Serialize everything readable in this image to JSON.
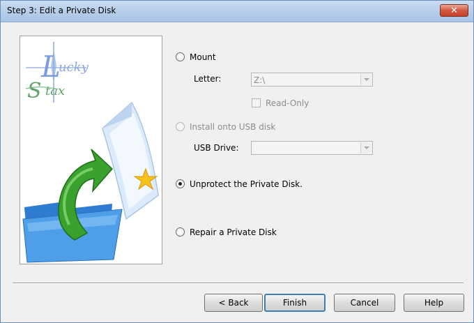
{
  "window": {
    "title": "Step 3: Edit a Private Disk",
    "close_glyph": "✕"
  },
  "logo": {
    "brand_text": "Lucky Stax"
  },
  "options": {
    "mount": {
      "label": "Mount",
      "selected": false
    },
    "letter": {
      "label": "Letter:",
      "value": "Z:\\"
    },
    "read_only": {
      "label": "Read-Only",
      "checked": false
    },
    "install_usb": {
      "label": "Install onto USB disk",
      "enabled": false
    },
    "usb_drive": {
      "label": "USB Drive:",
      "value": ""
    },
    "unprotect": {
      "label": "Unprotect the Private Disk.",
      "selected": true
    },
    "repair": {
      "label": "Repair a Private Disk",
      "selected": false
    }
  },
  "buttons": {
    "back": "< Back",
    "finish": "Finish",
    "cancel": "Cancel",
    "help": "Help"
  },
  "colors": {
    "titlebar": "#b5cde9",
    "close": "#c6412a",
    "default_button_border": "#3c7fb1",
    "arrow_green": "#3aa02e",
    "folder_blue": "#3b8fdc"
  }
}
